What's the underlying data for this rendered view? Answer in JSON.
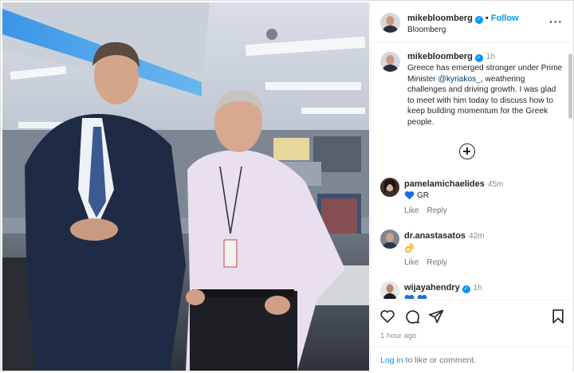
{
  "post": {
    "photo_alt": "",
    "author": {
      "username": "mikebloomberg",
      "verified": true,
      "follow_label": "Follow",
      "separator": "•",
      "subtitle": "Bloomberg"
    },
    "more_icon": "more-horizontal-icon",
    "caption": {
      "username": "mikebloomberg",
      "time": "1h",
      "text_before": "Greece has emerged stronger under Prime Minister ",
      "mention": "@kyriakos_",
      "text_after": ", weathering challenges and driving growth. I was glad to meet with him today to discuss how to keep building momentum for the Greek people."
    },
    "load_more_icon": "plus-circle-icon",
    "comments": [
      {
        "username": "pamelamichaelides",
        "verified": false,
        "time": "45m",
        "emoji": "blue-heart",
        "text": "GR",
        "like_label": "Like",
        "reply_label": "Reply"
      },
      {
        "username": "dr.anastasatos",
        "verified": false,
        "time": "42m",
        "emoji": "ok-hand",
        "text": "",
        "like_label": "Like",
        "reply_label": "Reply"
      },
      {
        "username": "wijayahendry",
        "verified": true,
        "time": "1h",
        "emoji": "blue-heart",
        "text": "",
        "like_label": "",
        "reply_label": ""
      }
    ],
    "actions": {
      "like_icon": "heart-icon",
      "comment_icon": "comment-icon",
      "share_icon": "send-icon",
      "save_icon": "bookmark-icon"
    },
    "timestamp": "1 hour ago",
    "login_link": "Log in",
    "login_suffix": " to like or comment."
  },
  "colors": {
    "accent": "#0095f6",
    "text": "#262626",
    "muted": "#8e8e8e",
    "heart_blue": "#1d6fe0"
  }
}
